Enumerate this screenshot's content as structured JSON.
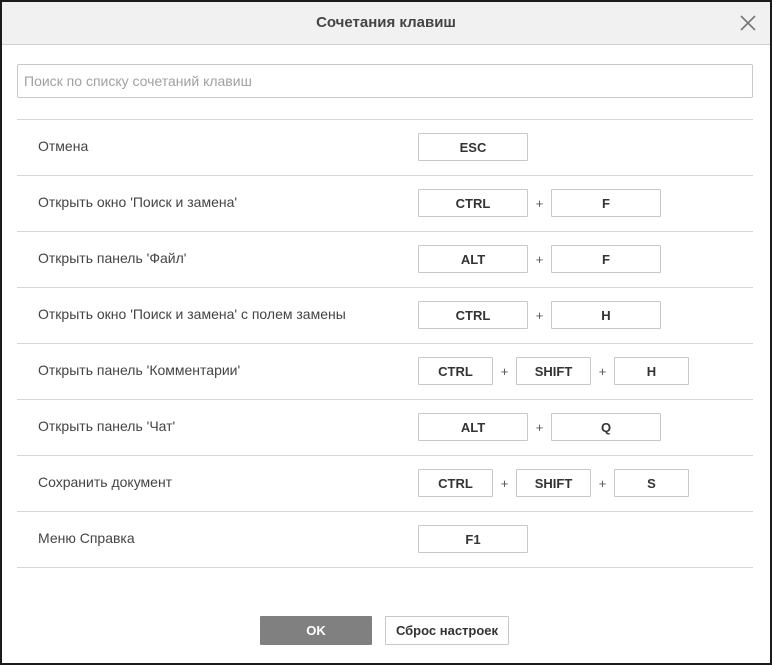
{
  "dialog": {
    "title": "Сочетания клавиш",
    "close_icon": "close-icon"
  },
  "search": {
    "placeholder": "Поиск по списку сочетаний клавиш",
    "value": ""
  },
  "shortcuts": [
    {
      "label": "Отмена",
      "keys": [
        "ESC"
      ]
    },
    {
      "label": "Открыть окно 'Поиск и замена'",
      "keys": [
        "CTRL",
        "F"
      ]
    },
    {
      "label": "Открыть панель 'Файл'",
      "keys": [
        "ALT",
        "F"
      ]
    },
    {
      "label": "Открыть окно 'Поиск и замена' с полем замены",
      "keys": [
        "CTRL",
        "H"
      ]
    },
    {
      "label": "Открыть панель 'Комментарии'",
      "keys": [
        "CTRL",
        "SHIFT",
        "H"
      ]
    },
    {
      "label": "Открыть панель 'Чат'",
      "keys": [
        "ALT",
        "Q"
      ]
    },
    {
      "label": "Сохранить документ",
      "keys": [
        "CTRL",
        "SHIFT",
        "S"
      ]
    },
    {
      "label": "Меню Справка",
      "keys": [
        "F1"
      ]
    }
  ],
  "key_separator": "+",
  "footer": {
    "ok_label": "OK",
    "reset_label": "Сброс настроек"
  },
  "colors": {
    "ok_button_bg": "#808080",
    "header_bg": "#f1f1f1",
    "border": "#d6d6d6"
  }
}
